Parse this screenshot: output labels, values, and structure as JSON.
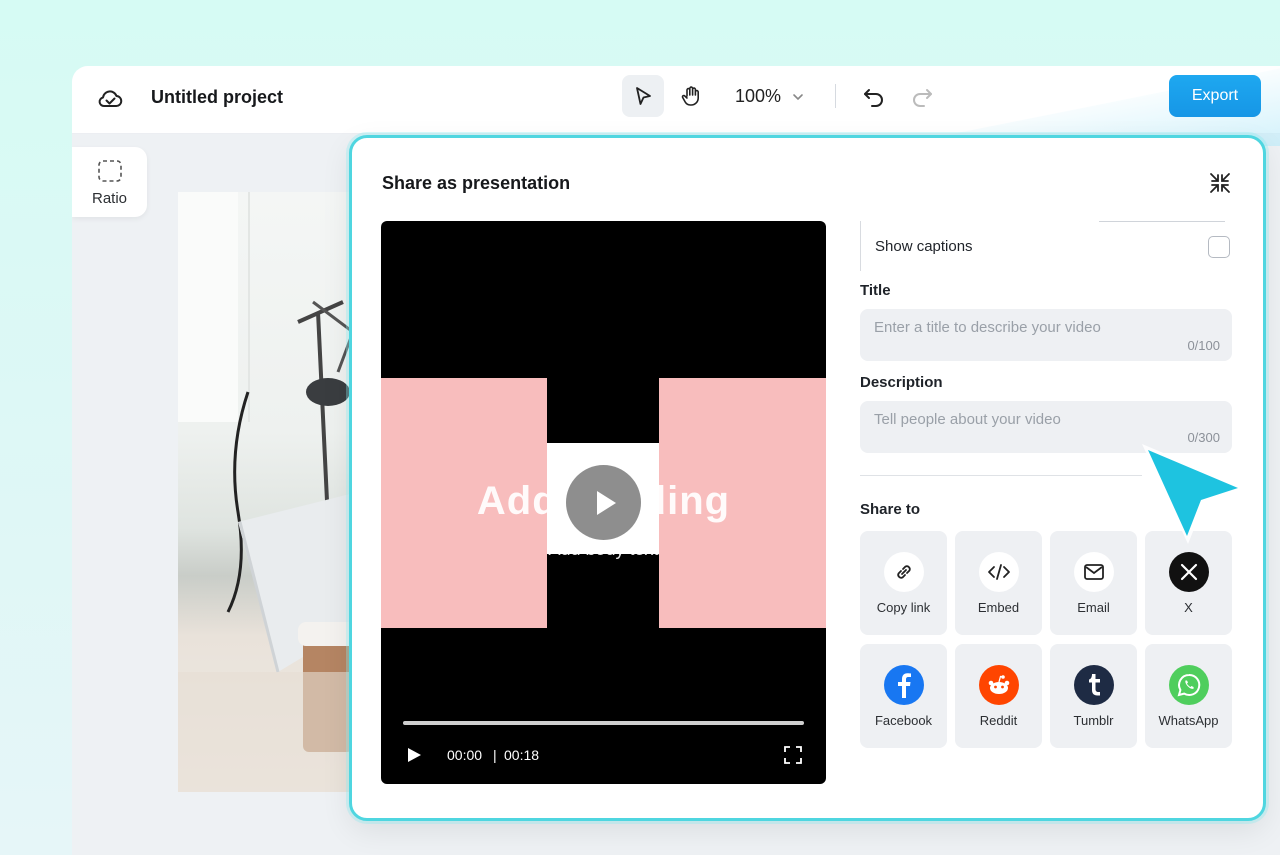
{
  "header": {
    "project_title": "Untitled project",
    "zoom": "100%",
    "export_label": "Export"
  },
  "sidebar": {
    "ratio_label": "Ratio"
  },
  "modal": {
    "title": "Share as presentation",
    "video": {
      "slide_heading": "Add heading",
      "slide_subtext": "Add body text",
      "current_time": "00:00",
      "separator": "|",
      "duration": "00:18"
    },
    "show_captions_label": "Show captions",
    "title_field": {
      "label": "Title",
      "placeholder": "Enter a title to describe your video",
      "count": "0/100"
    },
    "description_field": {
      "label": "Description",
      "placeholder": "Tell people about your video",
      "count": "0/300"
    },
    "share_to_label": "Share to",
    "share_targets": [
      {
        "name": "Copy link",
        "icon": "link-icon",
        "color": "#ffffff"
      },
      {
        "name": "Embed",
        "icon": "code-icon",
        "color": "#ffffff"
      },
      {
        "name": "Email",
        "icon": "mail-icon",
        "color": "#ffffff"
      },
      {
        "name": "X",
        "icon": "x-logo-icon",
        "color": "#111111"
      },
      {
        "name": "Facebook",
        "icon": "facebook-logo-icon",
        "color": "#1877f2"
      },
      {
        "name": "Reddit",
        "icon": "reddit-logo-icon",
        "color": "#ff4500"
      },
      {
        "name": "Tumblr",
        "icon": "tumblr-logo-icon",
        "color": "#1e2b44"
      },
      {
        "name": "WhatsApp",
        "icon": "whatsapp-logo-icon",
        "color": "#4fce5d"
      }
    ]
  },
  "colors": {
    "accent": "#1696e6",
    "modal_border": "#4fd6e0",
    "cursor": "#1ec3e0"
  }
}
